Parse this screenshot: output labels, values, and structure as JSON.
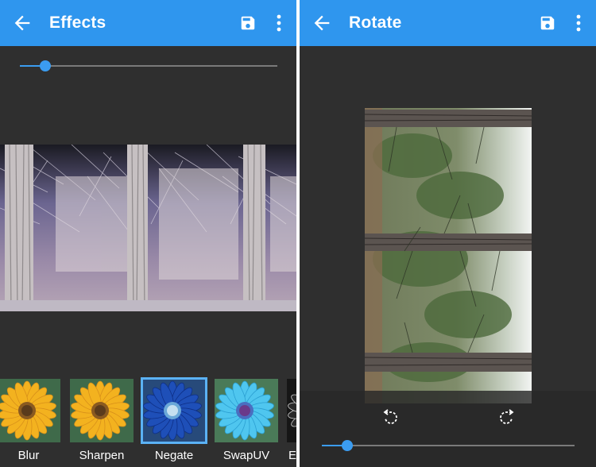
{
  "left_screen": {
    "title": "Effects",
    "slider_level_percent": 10,
    "thumbnails": [
      {
        "label": "Blur",
        "selected": false,
        "palette": "original"
      },
      {
        "label": "Sharpen",
        "selected": false,
        "palette": "original"
      },
      {
        "label": "Negate",
        "selected": true,
        "palette": "negate"
      },
      {
        "label": "SwapUV",
        "selected": false,
        "palette": "swapuv"
      },
      {
        "label": "Ec",
        "selected": false,
        "palette": "edge"
      }
    ]
  },
  "right_screen": {
    "title": "Rotate",
    "slider_level_percent": 10
  },
  "colors": {
    "app_bar": "#2f96ee",
    "background": "#2f2f2f",
    "accent": "#3b9cf0",
    "selection": "#5bb2f5"
  },
  "icons": [
    "back-arrow-icon",
    "save-icon",
    "more-vert-icon",
    "rotate-left-icon",
    "rotate-right-icon"
  ]
}
